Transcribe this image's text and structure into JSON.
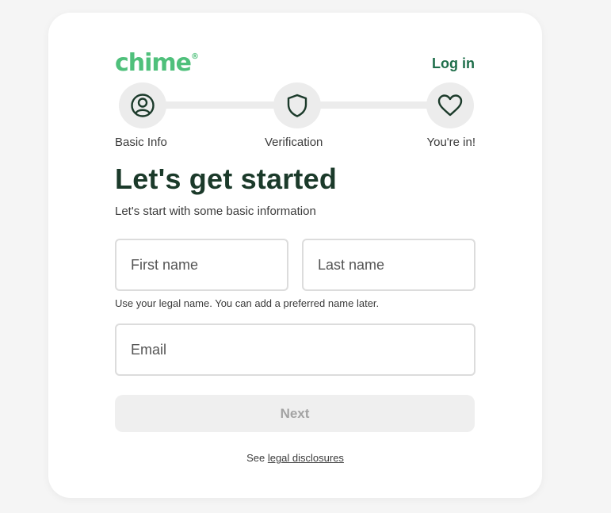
{
  "brand": {
    "logo_text": "chime",
    "logo_mark": "®",
    "color": "#4fc07b",
    "login_label": "Log in"
  },
  "steps": [
    {
      "label": "Basic Info",
      "icon": "user-circle-icon"
    },
    {
      "label": "Verification",
      "icon": "shield-icon"
    },
    {
      "label": "You're in!",
      "icon": "heart-icon"
    }
  ],
  "form": {
    "title": "Let's get started",
    "subtitle": "Let's start with some basic information",
    "first_name": {
      "value": "",
      "placeholder": "First name"
    },
    "last_name": {
      "value": "",
      "placeholder": "Last name"
    },
    "name_hint": "Use your legal name. You can add a preferred name later.",
    "email": {
      "value": "",
      "placeholder": "Email"
    },
    "next_label": "Next"
  },
  "footer": {
    "prefix": "See",
    "link_label": "legal disclosures"
  },
  "colors": {
    "heading": "#1b3a2a",
    "login": "#1e6e4a",
    "button_disabled_bg": "#efefef",
    "button_disabled_text": "#a3a3a3"
  }
}
